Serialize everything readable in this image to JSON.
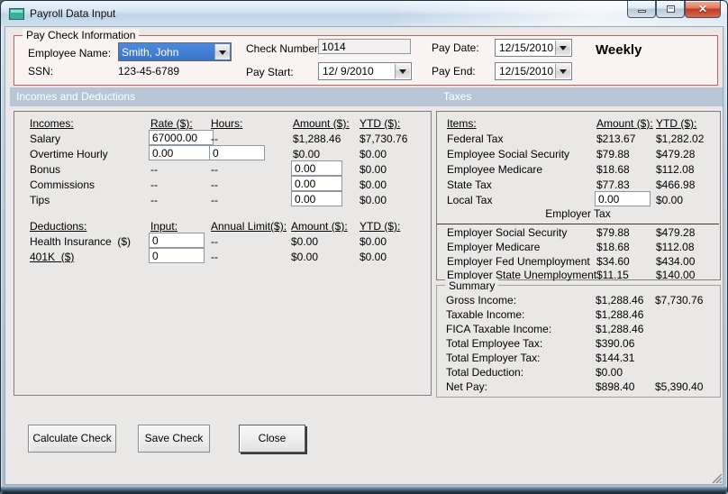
{
  "window": {
    "title": "Payroll Data Input"
  },
  "pay_check_info": {
    "legend": "Pay Check Information",
    "employee_name_label": "Employee Name:",
    "employee_name_value": "Smith, John",
    "ssn_label": "SSN:",
    "ssn_value": "123-45-6789",
    "check_number_label": "Check Number:",
    "check_number_value": "1014",
    "pay_start_label": "Pay Start:",
    "pay_start_value": "12/ 9/2010",
    "pay_date_label": "Pay Date:",
    "pay_date_value": "12/15/2010",
    "pay_end_label": "Pay End:",
    "pay_end_value": "12/15/2010",
    "frequency": "Weekly"
  },
  "section_headers": {
    "left": "Incomes and Deductions",
    "right": "Taxes"
  },
  "incomes": {
    "headers": {
      "name": "Incomes:",
      "rate": "Rate ($):",
      "hours": "Hours:",
      "amount": "Amount ($):",
      "ytd": "YTD ($):"
    },
    "rows": [
      {
        "name": "Salary",
        "rate": "67000.00",
        "hours": "--",
        "amount": "$1,288.46",
        "ytd": "$7,730.76"
      },
      {
        "name": "Overtime Hourly",
        "rate": "0.00",
        "hours": "0",
        "amount": "$0.00",
        "ytd": "$0.00"
      },
      {
        "name": "Bonus",
        "rate": "--",
        "hours": "--",
        "amount": "0.00",
        "ytd": "$0.00"
      },
      {
        "name": "Commissions",
        "rate": "--",
        "hours": "--",
        "amount": "0.00",
        "ytd": "$0.00"
      },
      {
        "name": "Tips",
        "rate": "--",
        "hours": "--",
        "amount": "0.00",
        "ytd": "$0.00"
      }
    ]
  },
  "deductions": {
    "headers": {
      "name": "Deductions:",
      "input": "Input:",
      "annual_limit": "Annual Limit($):",
      "amount": "Amount ($):",
      "ytd": "YTD ($):"
    },
    "rows": [
      {
        "name": "Health Insurance  ($)",
        "input": "0",
        "annual_limit": "--",
        "amount": "$0.00",
        "ytd": "$0.00"
      },
      {
        "name": "401K  ($)",
        "input": "0",
        "annual_limit": "--",
        "amount": "$0.00",
        "ytd": "$0.00"
      }
    ]
  },
  "taxes": {
    "headers": {
      "name": "Items:",
      "amount": "Amount ($):",
      "ytd": "YTD ($):"
    },
    "rows": [
      {
        "name": "Federal Tax",
        "amount": "$213.67",
        "ytd": "$1,282.02"
      },
      {
        "name": "Employee Social Security",
        "amount": "$79.88",
        "ytd": "$479.28"
      },
      {
        "name": "Employee Medicare",
        "amount": "$18.68",
        "ytd": "$112.08"
      },
      {
        "name": "State Tax",
        "amount": "$77.83",
        "ytd": "$466.98"
      },
      {
        "name": "Local Tax",
        "amount": "0.00",
        "ytd": "$0.00"
      }
    ],
    "employer_header": "Employer Tax",
    "employer_rows": [
      {
        "name": "Employer Social Security",
        "amount": "$79.88",
        "ytd": "$479.28"
      },
      {
        "name": "Employer Medicare",
        "amount": "$18.68",
        "ytd": "$112.08"
      },
      {
        "name": "Employer Fed Unemployment",
        "amount": "$34.60",
        "ytd": "$434.00"
      },
      {
        "name": "Employer State Unemployment",
        "amount": "$11.15",
        "ytd": "$140.00"
      }
    ]
  },
  "summary": {
    "legend": "Summary",
    "rows": [
      {
        "name": "Gross Income:",
        "amount": "$1,288.46",
        "ytd": "$7,730.76"
      },
      {
        "name": "Taxable Income:",
        "amount": "$1,288.46",
        "ytd": ""
      },
      {
        "name": "FICA Taxable Income:",
        "amount": "$1,288.46",
        "ytd": ""
      },
      {
        "name": "Total Employee Tax:",
        "amount": "$390.06",
        "ytd": ""
      },
      {
        "name": "Total Employer Tax:",
        "amount": "$144.31",
        "ytd": ""
      },
      {
        "name": "Total Deduction:",
        "amount": "$0.00",
        "ytd": ""
      },
      {
        "name": "Net Pay:",
        "amount": "$898.40",
        "ytd": "$5,390.40"
      }
    ]
  },
  "buttons": {
    "calculate": "Calculate Check",
    "save": "Save Check",
    "close": "Close"
  },
  "colors": {
    "section_header_bg": "#b7c5d4",
    "paycheck_border": "#c2605f",
    "combo_selected_bg": "#3a74c9",
    "close_button_red": "#c03a1f"
  }
}
